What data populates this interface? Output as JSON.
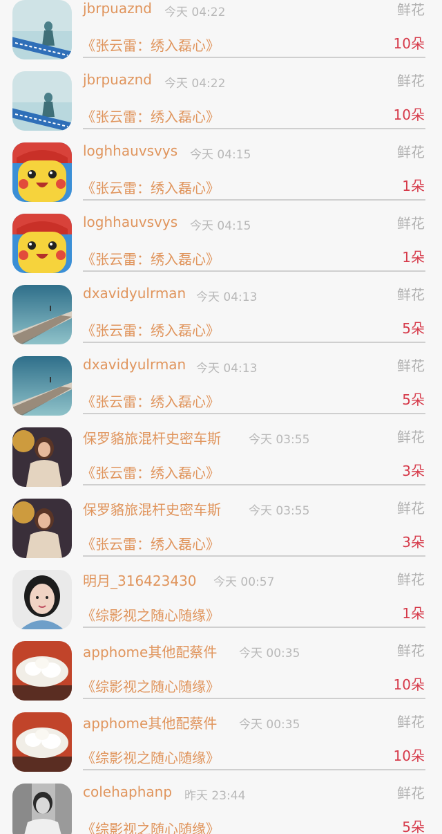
{
  "colors": {
    "background": "#f7f7f7",
    "username": "#e0955d",
    "time": "#b8b8b8",
    "gift": "#b0b0b0",
    "count": "#d63a4a"
  },
  "items": [
    {
      "user": "jbrpuaznd",
      "time": "今天 04:22",
      "gift": "鲜花",
      "title": "《张云雷：绣入磊心》",
      "count": "10朵",
      "avatar": "girl-sea-banner-avatar"
    },
    {
      "user": "jbrpuaznd",
      "time": "今天 04:22",
      "gift": "鲜花",
      "title": "《张云雷：绣入磊心》",
      "count": "10朵",
      "avatar": "girl-sea-banner-avatar"
    },
    {
      "user": "loghhauvsvys",
      "time": "今天 04:15",
      "gift": "鲜花",
      "title": "《张云雷：绣入磊心》",
      "count": "1朵",
      "avatar": "pikachu-avatar"
    },
    {
      "user": "loghhauvsvys",
      "time": "今天 04:15",
      "gift": "鲜花",
      "title": "《张云雷：绣入磊心》",
      "count": "1朵",
      "avatar": "pikachu-avatar"
    },
    {
      "user": "dxavidyulrman",
      "time": "今天 04:13",
      "gift": "鲜花",
      "title": "《张云雷：绣入磊心》",
      "count": "5朵",
      "avatar": "cliff-sea-avatar"
    },
    {
      "user": "dxavidyulrman",
      "time": "今天 04:13",
      "gift": "鲜花",
      "title": "《张云雷：绣入磊心》",
      "count": "5朵",
      "avatar": "cliff-sea-avatar"
    },
    {
      "user": "保罗貉旅混杆史密车斯",
      "time": "今天 03:55",
      "gift": "鲜花",
      "title": "《张云雷：绣入磊心》",
      "count": "3朵",
      "avatar": "woman-sunset-avatar"
    },
    {
      "user": "保罗貉旅混杆史密车斯",
      "time": "今天 03:55",
      "gift": "鲜花",
      "title": "《张云雷：绣入磊心》",
      "count": "3朵",
      "avatar": "woman-sunset-avatar"
    },
    {
      "user": "明月_316423430",
      "time": "今天 00:57",
      "gift": "鲜花",
      "title": "《综影视之随心随缘》",
      "count": "1朵",
      "avatar": "portrait-girl-avatar"
    },
    {
      "user": "apphome其他配蔡件",
      "time": "今天 00:35",
      "gift": "鲜花",
      "title": "《综影视之随心随缘》",
      "count": "10朵",
      "avatar": "white-flower-carving-avatar"
    },
    {
      "user": "apphome其他配蔡件",
      "time": "今天 00:35",
      "gift": "鲜花",
      "title": "《综影视之随心随缘》",
      "count": "10朵",
      "avatar": "white-flower-carving-avatar"
    },
    {
      "user": "colehaphanp",
      "time": "昨天 23:44",
      "gift": "鲜花",
      "title": "《综影视之随心随缘》",
      "count": "5朵",
      "avatar": "boy-bw-avatar"
    }
  ]
}
